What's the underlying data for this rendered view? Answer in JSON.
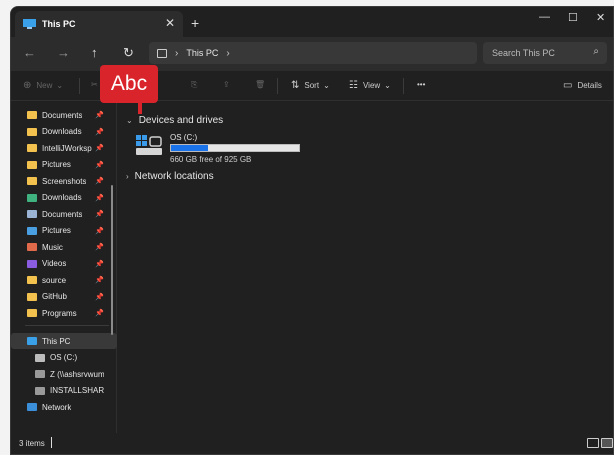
{
  "tab": {
    "title": "This PC"
  },
  "address": {
    "crumbs": [
      "This PC"
    ]
  },
  "search": {
    "placeholder": "Search This PC"
  },
  "commands": {
    "new": "New",
    "sort": "Sort",
    "view": "View",
    "more": "•••",
    "details": "Details"
  },
  "rename_badge": "Abc",
  "sidebar": {
    "pinned": [
      {
        "label": "Documents",
        "icon": "folder-icon"
      },
      {
        "label": "Downloads",
        "icon": "folder-icon"
      },
      {
        "label": "IntelliJWorksp",
        "icon": "folder-icon"
      },
      {
        "label": "Pictures",
        "icon": "folder-icon"
      },
      {
        "label": "Screenshots",
        "icon": "folder-icon"
      },
      {
        "label": "Downloads",
        "icon": "download-icon"
      },
      {
        "label": "Documents",
        "icon": "document-icon"
      },
      {
        "label": "Pictures",
        "icon": "picture-icon"
      },
      {
        "label": "Music",
        "icon": "music-icon"
      },
      {
        "label": "Videos",
        "icon": "video-icon"
      },
      {
        "label": "source",
        "icon": "folder-icon"
      },
      {
        "label": "GitHub",
        "icon": "folder-icon"
      },
      {
        "label": "Programs",
        "icon": "folder-icon"
      }
    ],
    "tree": [
      {
        "label": "This PC",
        "icon": "pc-icon",
        "selected": true
      },
      {
        "label": "OS (C:)",
        "icon": "drive-icon"
      },
      {
        "label": "Z (\\\\ashsrvwum",
        "icon": "network-drive-icon"
      },
      {
        "label": "INSTALLSHARE",
        "icon": "network-drive-icon"
      },
      {
        "label": "Network",
        "icon": "network-icon"
      }
    ]
  },
  "main": {
    "groups": {
      "devices": "Devices and drives",
      "network": "Network locations"
    },
    "drive": {
      "name": "OS (C:)",
      "free_text": "660 GB free of 925 GB",
      "used_fraction": 0.29
    }
  },
  "status": {
    "items": "3 items"
  },
  "colors": {
    "accent": "#1a73e8",
    "badge": "#d8242a"
  }
}
